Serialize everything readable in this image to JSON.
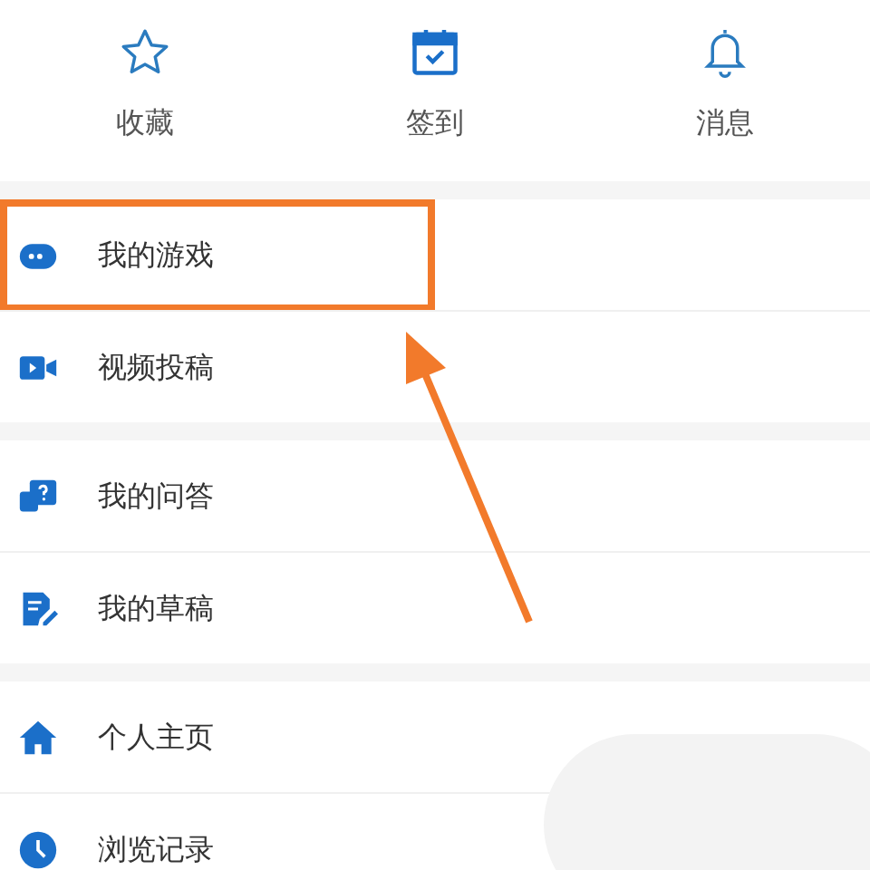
{
  "quick_actions": [
    {
      "label": "收藏"
    },
    {
      "label": "签到"
    },
    {
      "label": "消息"
    }
  ],
  "menu_sections": [
    [
      {
        "label": "我的游戏",
        "highlighted": true
      },
      {
        "label": "视频投稿",
        "highlighted": false
      }
    ],
    [
      {
        "label": "我的问答",
        "highlighted": false
      },
      {
        "label": "我的草稿",
        "highlighted": false
      }
    ],
    [
      {
        "label": "个人主页",
        "highlighted": false
      },
      {
        "label": "浏览记录",
        "highlighted": false
      }
    ]
  ]
}
